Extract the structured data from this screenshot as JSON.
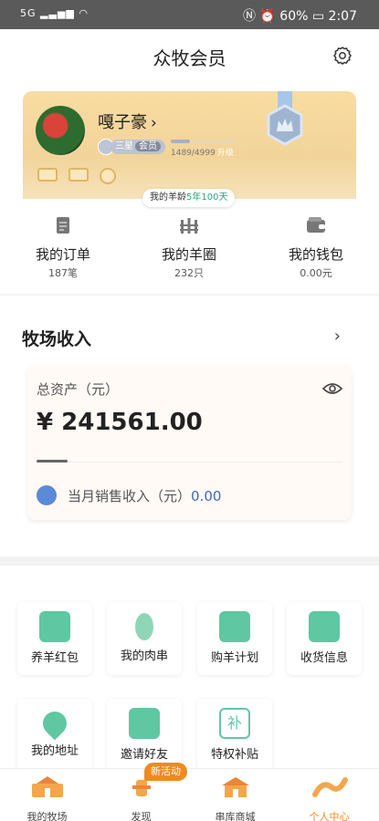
{
  "status_bar": {
    "network": "5G",
    "battery": "60%",
    "time": "2:07"
  },
  "header": {
    "title": "众牧会员"
  },
  "member": {
    "name": "嘎子豪",
    "level_text": "三星",
    "level_suffix": "会员",
    "progress_text": "1489/4999",
    "progress_fraction": 0.298,
    "upgrade_label": "升级",
    "age_prefix": "我的羊龄",
    "age_value": "5年100天"
  },
  "stats": [
    {
      "label": "我的订单",
      "value": "187笔",
      "icon": "orders-icon"
    },
    {
      "label": "我的羊圈",
      "value": "232只",
      "icon": "sheepfold-icon"
    },
    {
      "label": "我的钱包",
      "value": "0.00元",
      "icon": "wallet-icon"
    }
  ],
  "income": {
    "heading": "牧场收入",
    "asset_label": "总资产（元）",
    "asset_value": "¥ 241561.00",
    "month_label": "当月销售收入（元）",
    "month_value": "0.00"
  },
  "tiles": [
    {
      "label": "养羊红包",
      "icon": "red-packet-icon"
    },
    {
      "label": "我的肉串",
      "icon": "skewer-icon"
    },
    {
      "label": "购羊计划",
      "icon": "calendar-icon"
    },
    {
      "label": "收货信息",
      "icon": "delivery-info-icon"
    },
    {
      "label": "我的地址",
      "icon": "location-icon"
    },
    {
      "label": "邀请好友",
      "icon": "invite-icon"
    },
    {
      "label": "特权补贴",
      "icon": "subsidy-icon"
    }
  ],
  "tabbar": {
    "badge": "新活动",
    "items": [
      {
        "label": "我的牧场",
        "icon": "ranch-icon"
      },
      {
        "label": "发现",
        "icon": "discover-icon"
      },
      {
        "label": "串库商城",
        "icon": "mall-icon"
      },
      {
        "label": "个人中心",
        "icon": "profile-icon"
      }
    ]
  },
  "colors": {
    "accent": "#f0871f",
    "green": "#4bbd95",
    "gold": "#f2d49a",
    "link_blue": "#3c67c8"
  }
}
